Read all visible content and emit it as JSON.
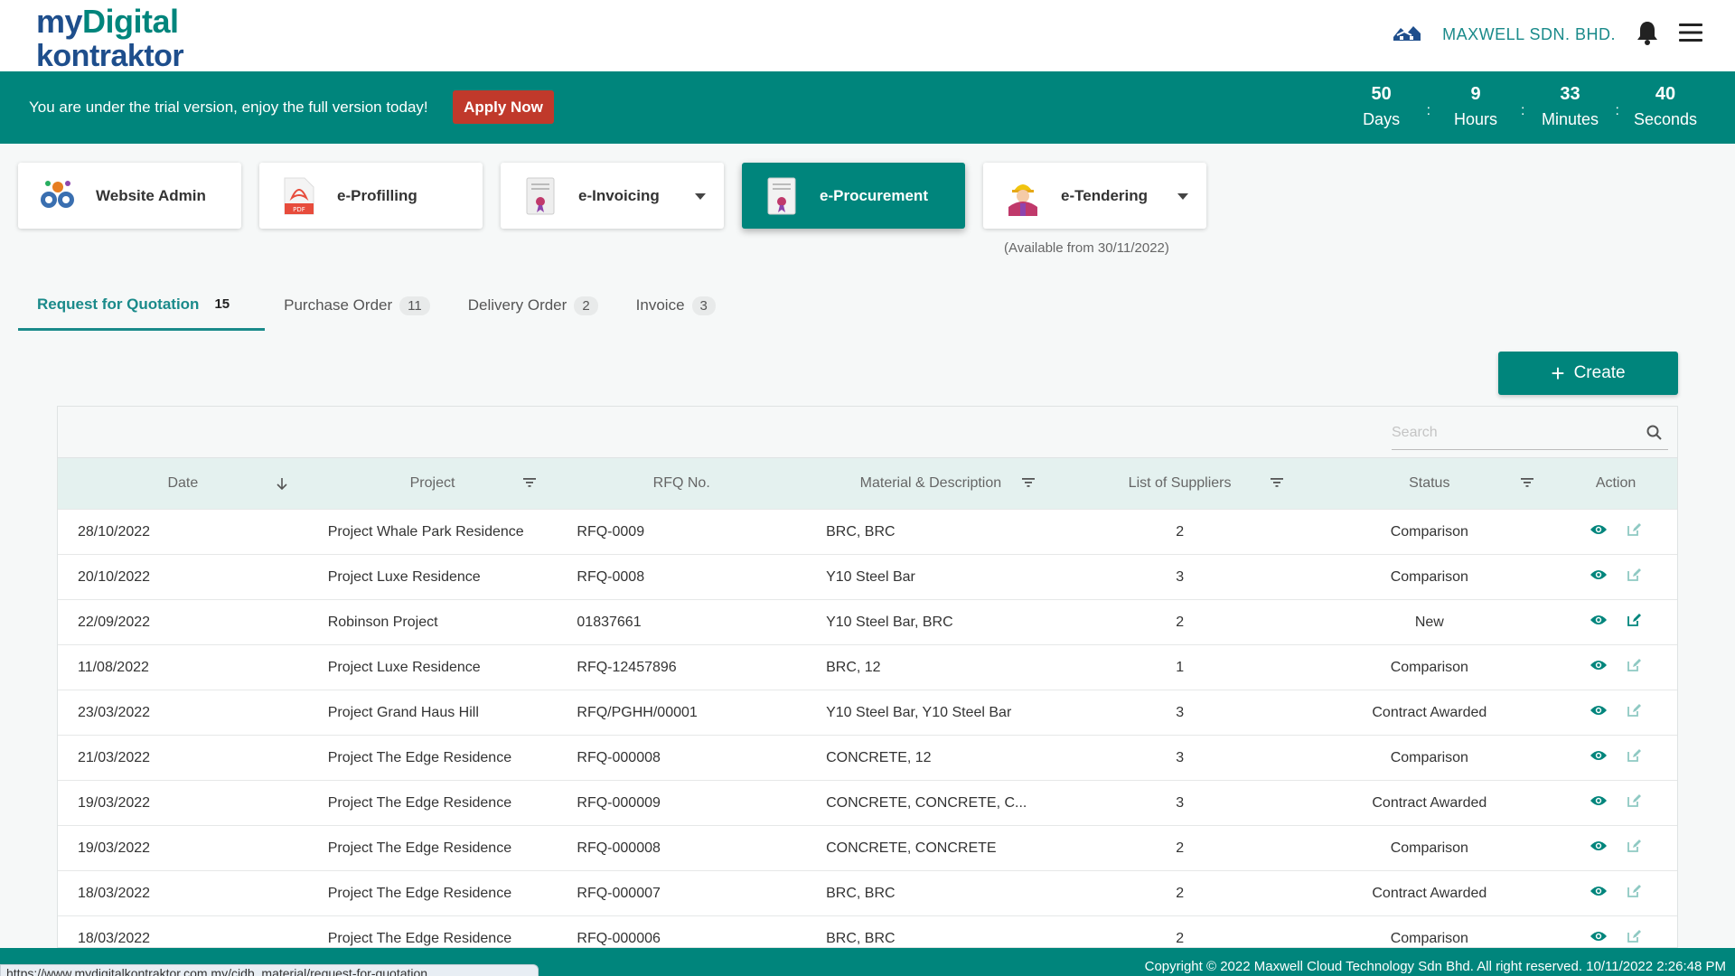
{
  "header": {
    "logo_line1_a": "my",
    "logo_line1_b": "Digital",
    "logo_line2": "kontraktor",
    "company_name": "MAXWELL SDN. BHD.",
    "icons": [
      "company-logo-icon",
      "bell-icon",
      "hamburger-menu-icon"
    ]
  },
  "banner": {
    "text": "You are under the trial version, enjoy the full version today!",
    "apply_label": "Apply Now",
    "countdown": {
      "days": "50",
      "days_label": "Days",
      "hours": "9",
      "hours_label": "Hours",
      "minutes": "33",
      "minutes_label": "Minutes",
      "seconds": "40",
      "seconds_label": "Seconds",
      "separator": ":"
    }
  },
  "modules": [
    {
      "label": "Website Admin",
      "icon": "gears-icon"
    },
    {
      "label": "e-Profilling",
      "icon": "pdf-icon"
    },
    {
      "label": "e-Invoicing",
      "icon": "invoice-icon"
    },
    {
      "label": "e-Procurement",
      "icon": "procurement-document-icon"
    },
    {
      "label": "e-Tendering",
      "icon": "worker-icon"
    }
  ],
  "tendering_note": "(Available from 30/11/2022)",
  "tabs": [
    {
      "label": "Request for Quotation",
      "count": "15"
    },
    {
      "label": "Purchase Order",
      "count": "11"
    },
    {
      "label": "Delivery Order",
      "count": "2"
    },
    {
      "label": "Invoice",
      "count": "3"
    }
  ],
  "create_label": "Create",
  "search_placeholder": "Search",
  "columns": {
    "date": "Date",
    "project": "Project",
    "rfq": "RFQ No.",
    "material": "Material & Description",
    "suppliers": "List of Suppliers",
    "status": "Status",
    "action": "Action"
  },
  "rows": [
    {
      "date": "28/10/2022",
      "project": "Project Whale Park Residence",
      "rfq": "RFQ-0009",
      "material": "BRC, BRC",
      "suppliers": "2",
      "status": "Comparison"
    },
    {
      "date": "20/10/2022",
      "project": "Project Luxe Residence",
      "rfq": "RFQ-0008",
      "material": "Y10 Steel Bar",
      "suppliers": "3",
      "status": "Comparison"
    },
    {
      "date": "22/09/2022",
      "project": "Robinson Project",
      "rfq": "01837661",
      "material": "Y10 Steel Bar, BRC",
      "suppliers": "2",
      "status": "New"
    },
    {
      "date": "11/08/2022",
      "project": "Project Luxe Residence",
      "rfq": "RFQ-12457896",
      "material": "BRC, 12",
      "suppliers": "1",
      "status": "Comparison"
    },
    {
      "date": "23/03/2022",
      "project": "Project Grand Haus Hill",
      "rfq": "RFQ/PGHH/00001",
      "material": "Y10 Steel Bar, Y10 Steel Bar",
      "suppliers": "3",
      "status": "Contract Awarded"
    },
    {
      "date": "21/03/2022",
      "project": "Project The Edge Residence",
      "rfq": "RFQ-000008",
      "material": "CONCRETE, 12",
      "suppliers": "3",
      "status": "Comparison"
    },
    {
      "date": "19/03/2022",
      "project": "Project The Edge Residence",
      "rfq": "RFQ-000009",
      "material": "CONCRETE, CONCRETE, C...",
      "suppliers": "3",
      "status": "Contract Awarded"
    },
    {
      "date": "19/03/2022",
      "project": "Project The Edge Residence",
      "rfq": "RFQ-000008",
      "material": "CONCRETE, CONCRETE",
      "suppliers": "2",
      "status": "Comparison"
    },
    {
      "date": "18/03/2022",
      "project": "Project The Edge Residence",
      "rfq": "RFQ-000007",
      "material": "BRC, BRC",
      "suppliers": "2",
      "status": "Contract Awarded"
    },
    {
      "date": "18/03/2022",
      "project": "Project The Edge Residence",
      "rfq": "RFQ-000006",
      "material": "BRC, BRC",
      "suppliers": "2",
      "status": "Comparison"
    }
  ],
  "footer_text": "Copyright © 2022 Maxwell Cloud Technology Sdn Bhd. All right reserved. 10/11/2022 2:26:48 PM",
  "status_url": "https://www.mydigitalkontraktor.com.my/cidb_material/request-for-quotation",
  "colors": {
    "brand_teal": "#00857c",
    "apply_red": "#c0392b",
    "header_row": "#e4f1ef"
  }
}
